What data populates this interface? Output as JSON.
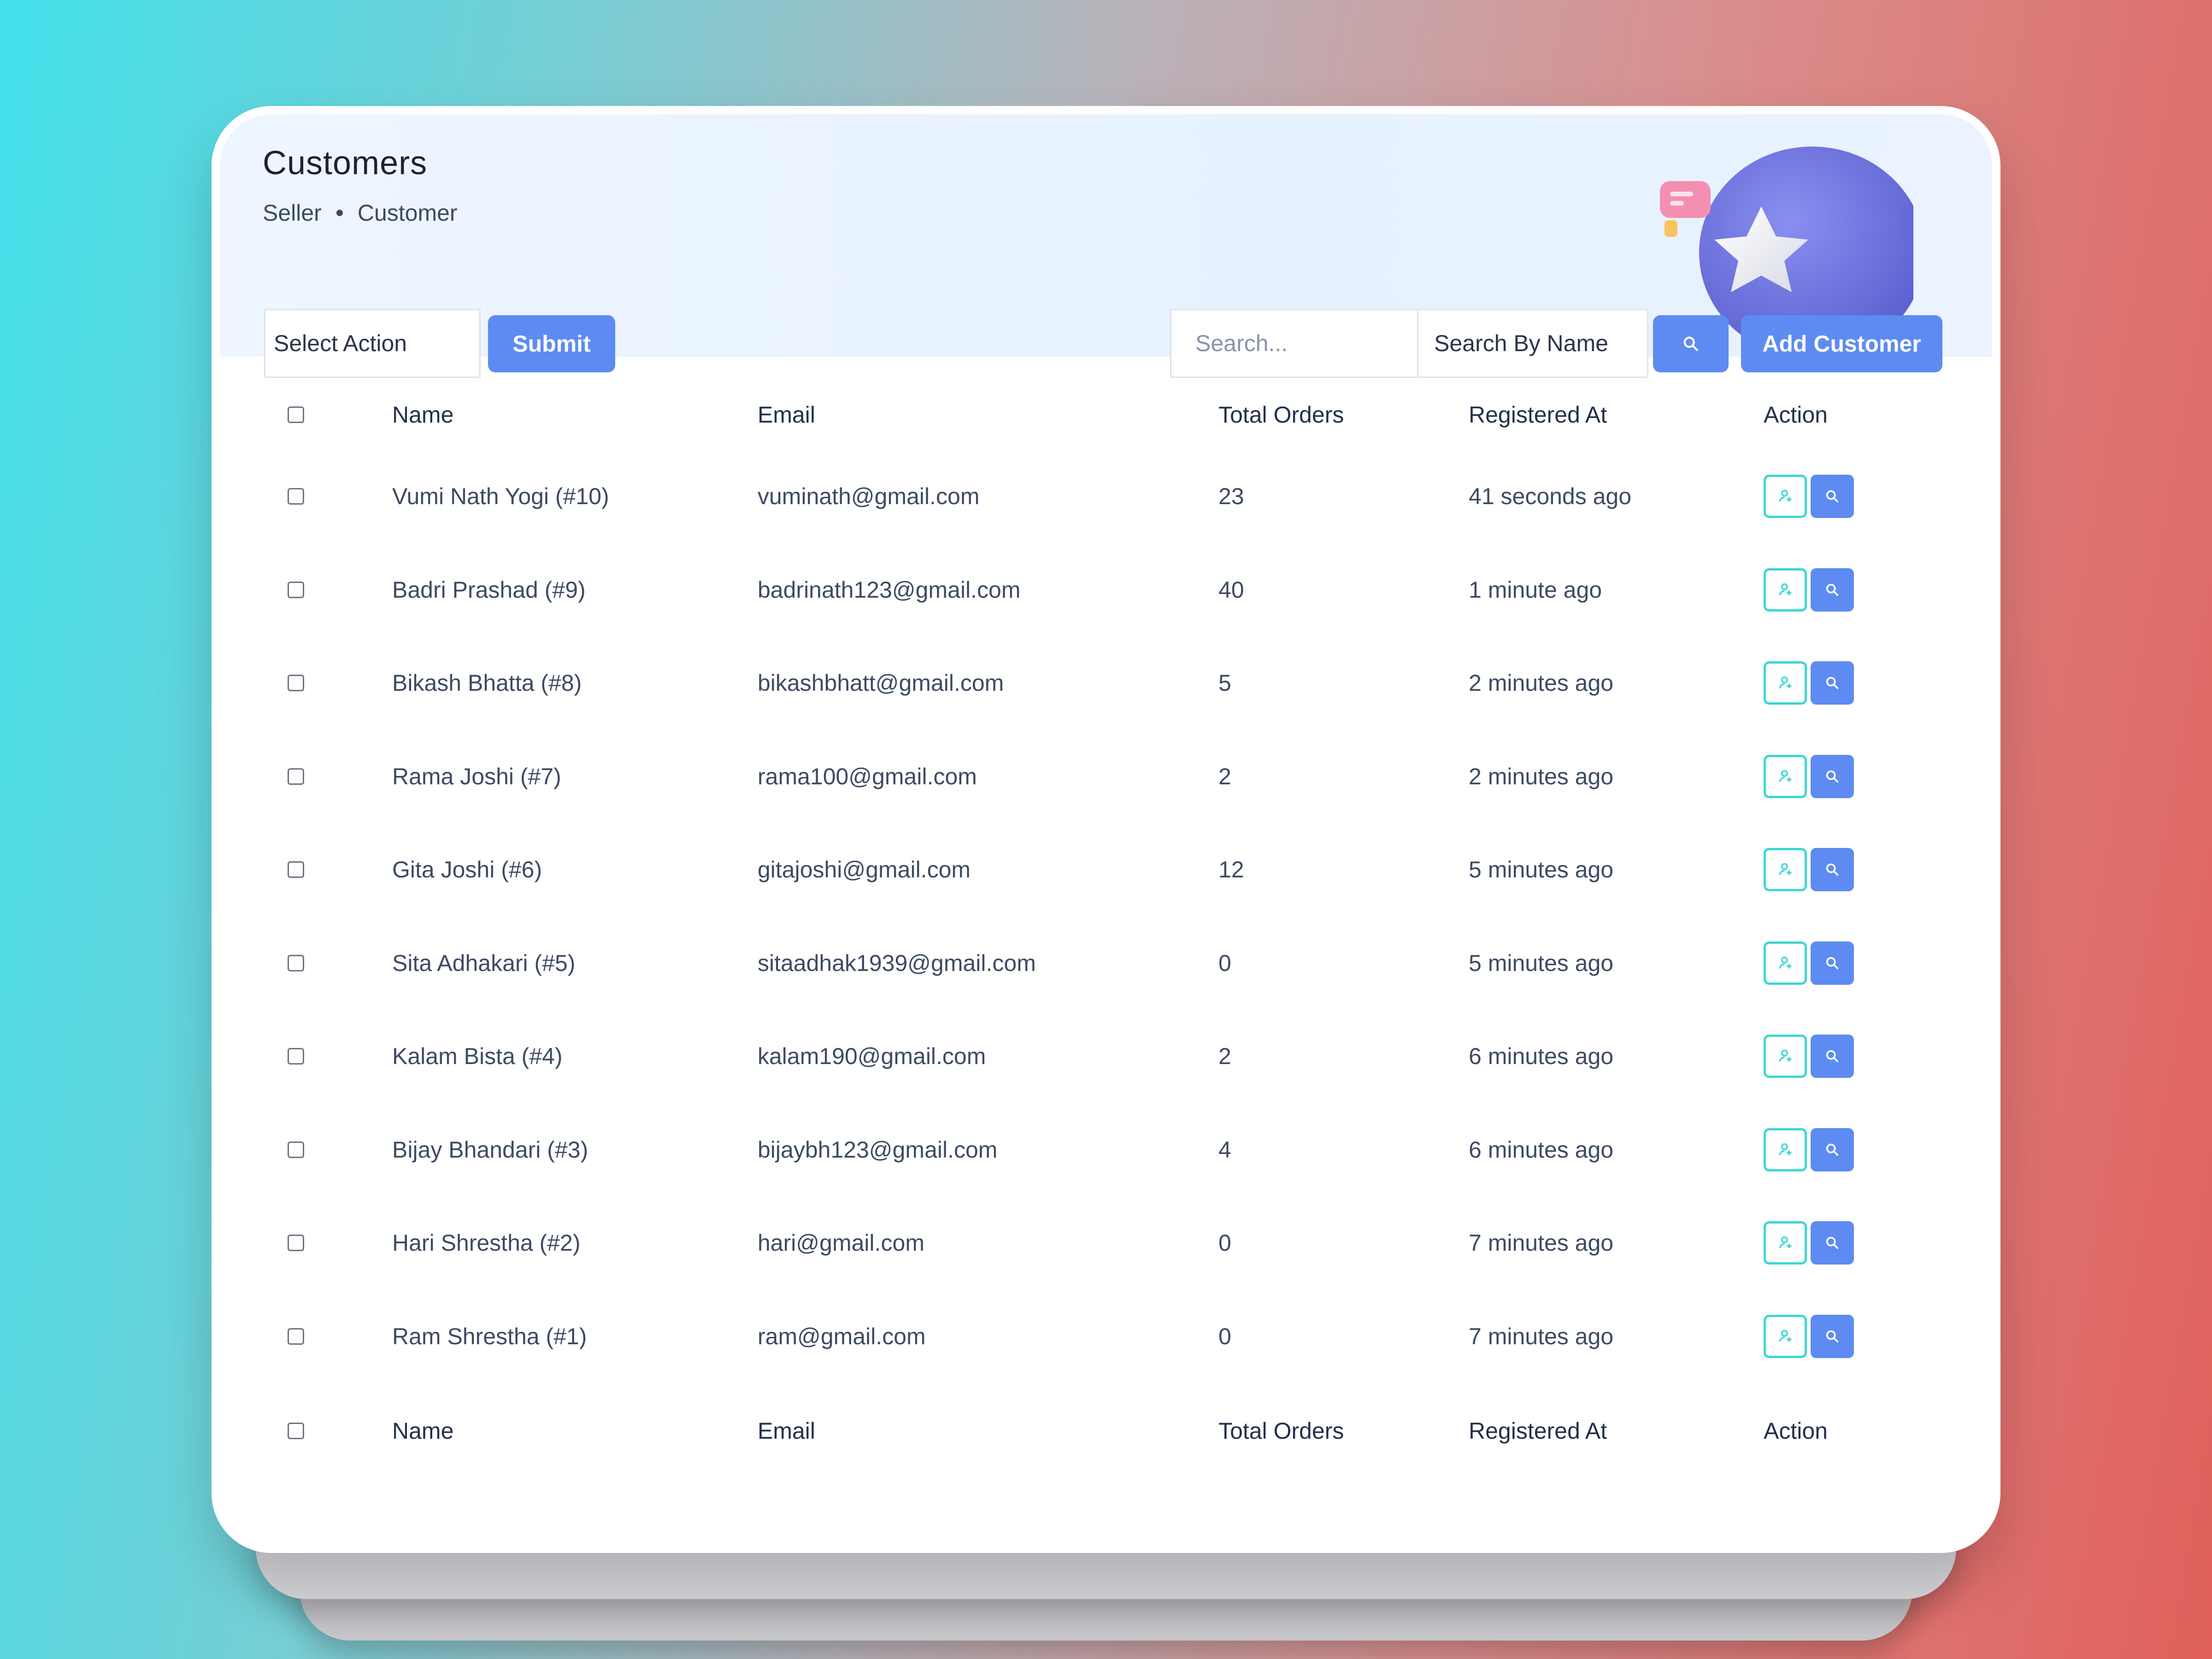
{
  "header": {
    "title": "Customers",
    "breadcrumb": [
      "Seller",
      "Customer"
    ]
  },
  "toolbar": {
    "select_action": "Select Action",
    "submit_label": "Submit",
    "search_placeholder": "Search...",
    "search_by": "Search By Name",
    "add_label": "Add Customer"
  },
  "table": {
    "columns": [
      "Name",
      "Email",
      "Total Orders",
      "Registered At",
      "Action"
    ],
    "rows": [
      {
        "name": "Vumi Nath Yogi (#10)",
        "email": "vuminath@gmail.com",
        "orders": "23",
        "registered": "41 seconds ago"
      },
      {
        "name": "Badri Prashad (#9)",
        "email": "badrinath123@gmail.com",
        "orders": "40",
        "registered": "1 minute ago"
      },
      {
        "name": "Bikash Bhatta (#8)",
        "email": "bikashbhatt@gmail.com",
        "orders": "5",
        "registered": "2 minutes ago"
      },
      {
        "name": "Rama Joshi (#7)",
        "email": "rama100@gmail.com",
        "orders": "2",
        "registered": "2 minutes ago"
      },
      {
        "name": "Gita Joshi (#6)",
        "email": "gitajoshi@gmail.com",
        "orders": "12",
        "registered": "5 minutes ago"
      },
      {
        "name": "Sita Adhakari (#5)",
        "email": "sitaadhak1939@gmail.com",
        "orders": "0",
        "registered": "5 minutes ago"
      },
      {
        "name": "Kalam Bista (#4)",
        "email": "kalam190@gmail.com",
        "orders": "2",
        "registered": "6 minutes ago"
      },
      {
        "name": "Bijay Bhandari (#3)",
        "email": "bijaybh123@gmail.com",
        "orders": "4",
        "registered": "6 minutes ago"
      },
      {
        "name": "Hari Shrestha (#2)",
        "email": "hari@gmail.com",
        "orders": "0",
        "registered": "7 minutes ago"
      },
      {
        "name": "Ram Shrestha (#1)",
        "email": "ram@gmail.com",
        "orders": "0",
        "registered": "7 minutes ago"
      }
    ]
  },
  "icons": {
    "row_action_1": "user-icon",
    "row_action_2": "search-icon",
    "toolbar_search": "search-icon"
  },
  "colors": {
    "primary": "#5d8bf2",
    "teal": "#3ad8d2"
  }
}
